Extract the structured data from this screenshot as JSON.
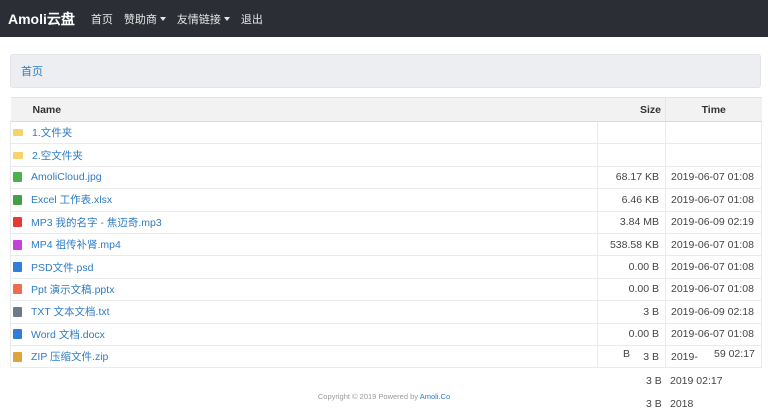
{
  "navbar": {
    "brand": "Amoli云盘",
    "items": [
      {
        "label": "首页",
        "dropdown": false
      },
      {
        "label": "赞助商",
        "dropdown": true
      },
      {
        "label": "友情链接",
        "dropdown": true
      },
      {
        "label": "退出",
        "dropdown": false
      }
    ]
  },
  "breadcrumb": {
    "home": "首页"
  },
  "table": {
    "headers": {
      "name": "Name",
      "size": "Size",
      "time": "Time"
    },
    "rows": [
      {
        "icon": "folder-icon",
        "color": "#f5d46b",
        "name": "1.文件夹",
        "size": "",
        "time": ""
      },
      {
        "icon": "folder-icon",
        "color": "#f5d46b",
        "name": "2.空文件夹",
        "size": "",
        "time": ""
      },
      {
        "icon": "image-file-icon",
        "color": "#4caf50",
        "name": "AmoliCloud.jpg",
        "size": "68.17 KB",
        "time": "2019-06-07 01:08"
      },
      {
        "icon": "excel-file-icon",
        "color": "#43a047",
        "name": "Excel 工作表.xlsx",
        "size": "6.46 KB",
        "time": "2019-06-07 01:08"
      },
      {
        "icon": "audio-file-icon",
        "color": "#e53935",
        "name": "MP3 我的名字 - 焦迈奇.mp3",
        "size": "3.84 MB",
        "time": "2019-06-09 02:19"
      },
      {
        "icon": "video-file-icon",
        "color": "#c542d6",
        "name": "MP4 祖传补肾.mp4",
        "size": "538.58 KB",
        "time": "2019-06-07 01:08"
      },
      {
        "icon": "psd-file-icon",
        "color": "#2f7ed8",
        "name": "PSD文件.psd",
        "size": "0.00 B",
        "time": "2019-06-07 01:08"
      },
      {
        "icon": "ppt-file-icon",
        "color": "#ef6c50",
        "name": "Ppt 演示文稿.pptx",
        "size": "0.00 B",
        "time": "2019-06-07 01:08"
      },
      {
        "icon": "txt-file-icon",
        "color": "#6d7a8a",
        "name": "TXT 文本文档.txt",
        "size": "3 B",
        "time": "2019-06-09 02:18"
      },
      {
        "icon": "word-file-icon",
        "color": "#2f7ed8",
        "name": "Word 文档.docx",
        "size": "0.00 B",
        "time": "2019-06-07 01:08"
      },
      {
        "icon": "zip-file-icon",
        "color": "#e0a23a",
        "name": "ZIP 压缩文件.zip",
        "size": "3 B",
        "time": "2019-"
      }
    ],
    "overflow": [
      {
        "size": "B",
        "time": "59 02:17"
      },
      {
        "size": "3 B",
        "time": "2019 02:17"
      },
      {
        "size": "3 B",
        "time": "2018"
      }
    ]
  },
  "footer": {
    "text": "Copyright © 2019 Powered by ",
    "link": "Amoli.Co"
  }
}
